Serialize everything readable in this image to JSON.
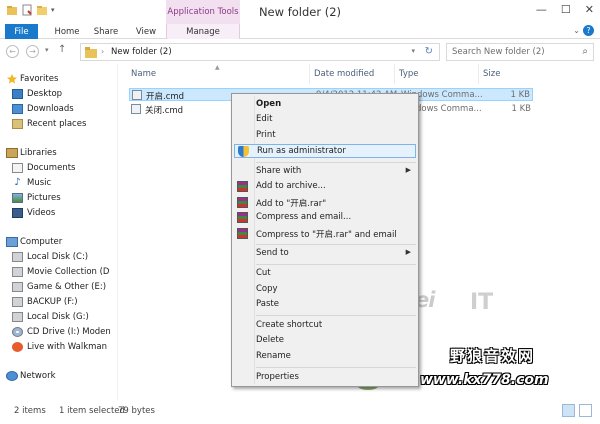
{
  "window": {
    "title": "New folder (2)",
    "app_tools": "Application Tools"
  },
  "tabs": [
    {
      "label": "File"
    },
    {
      "label": "Home"
    },
    {
      "label": "Share"
    },
    {
      "label": "View"
    },
    {
      "label": "Manage"
    }
  ],
  "address": {
    "path": "New folder (2)",
    "search_placeholder": "Search New folder (2)"
  },
  "nav": {
    "favorites": "Favorites",
    "favorites_items": [
      "Desktop",
      "Downloads",
      "Recent places"
    ],
    "libraries": "Libraries",
    "libraries_items": [
      "Documents",
      "Music",
      "Pictures",
      "Videos"
    ],
    "computer": "Computer",
    "computer_items": [
      "Local Disk (C:)",
      "Movie Collection (D",
      "Game & Other (E:)",
      "BACKUP (F:)",
      "Local Disk (G:)",
      "CD Drive (I:) Moden",
      "Live with Walkman"
    ],
    "network": "Network"
  },
  "columns": {
    "name": "Name",
    "date": "Date modified",
    "type": "Type",
    "size": "Size"
  },
  "files": [
    {
      "name": "开启.cmd",
      "date": "9/4/2012 11:42 AM",
      "type": "Windows Comma...",
      "size": "1 KB"
    },
    {
      "name": "关闭.cmd",
      "date": "",
      "type": "Windows Comma...",
      "size": "1 KB"
    }
  ],
  "context_menu": {
    "open": "Open",
    "edit": "Edit",
    "print": "Print",
    "run_as_admin": "Run as administrator",
    "share_with": "Share with",
    "add_to_archive": "Add to archive...",
    "add_to_rar": "Add to \"开启.rar\"",
    "compress_email": "Compress and email...",
    "compress_rar_email": "Compress to \"开启.rar\" and email",
    "send_to": "Send to",
    "cut": "Cut",
    "copy": "Copy",
    "paste": "Paste",
    "create_shortcut": "Create shortcut",
    "delete": "Delete",
    "rename": "Rename",
    "properties": "Properties"
  },
  "status": {
    "items": "2 items",
    "selected": "1 item selected",
    "size": "79 bytes"
  },
  "watermark": {
    "brand": "RuanMei",
    "it": "IT",
    "site_cn": "野狼音效网",
    "site_url": "www.kx778.com"
  },
  "colors": {
    "accent": "#1979ca",
    "selection": "#cce8ff",
    "app_tools": "#f2dfef"
  },
  "icons": {
    "folder": "folder-icon",
    "shield": "uac-shield-icon",
    "rar": "winrar-icon"
  }
}
